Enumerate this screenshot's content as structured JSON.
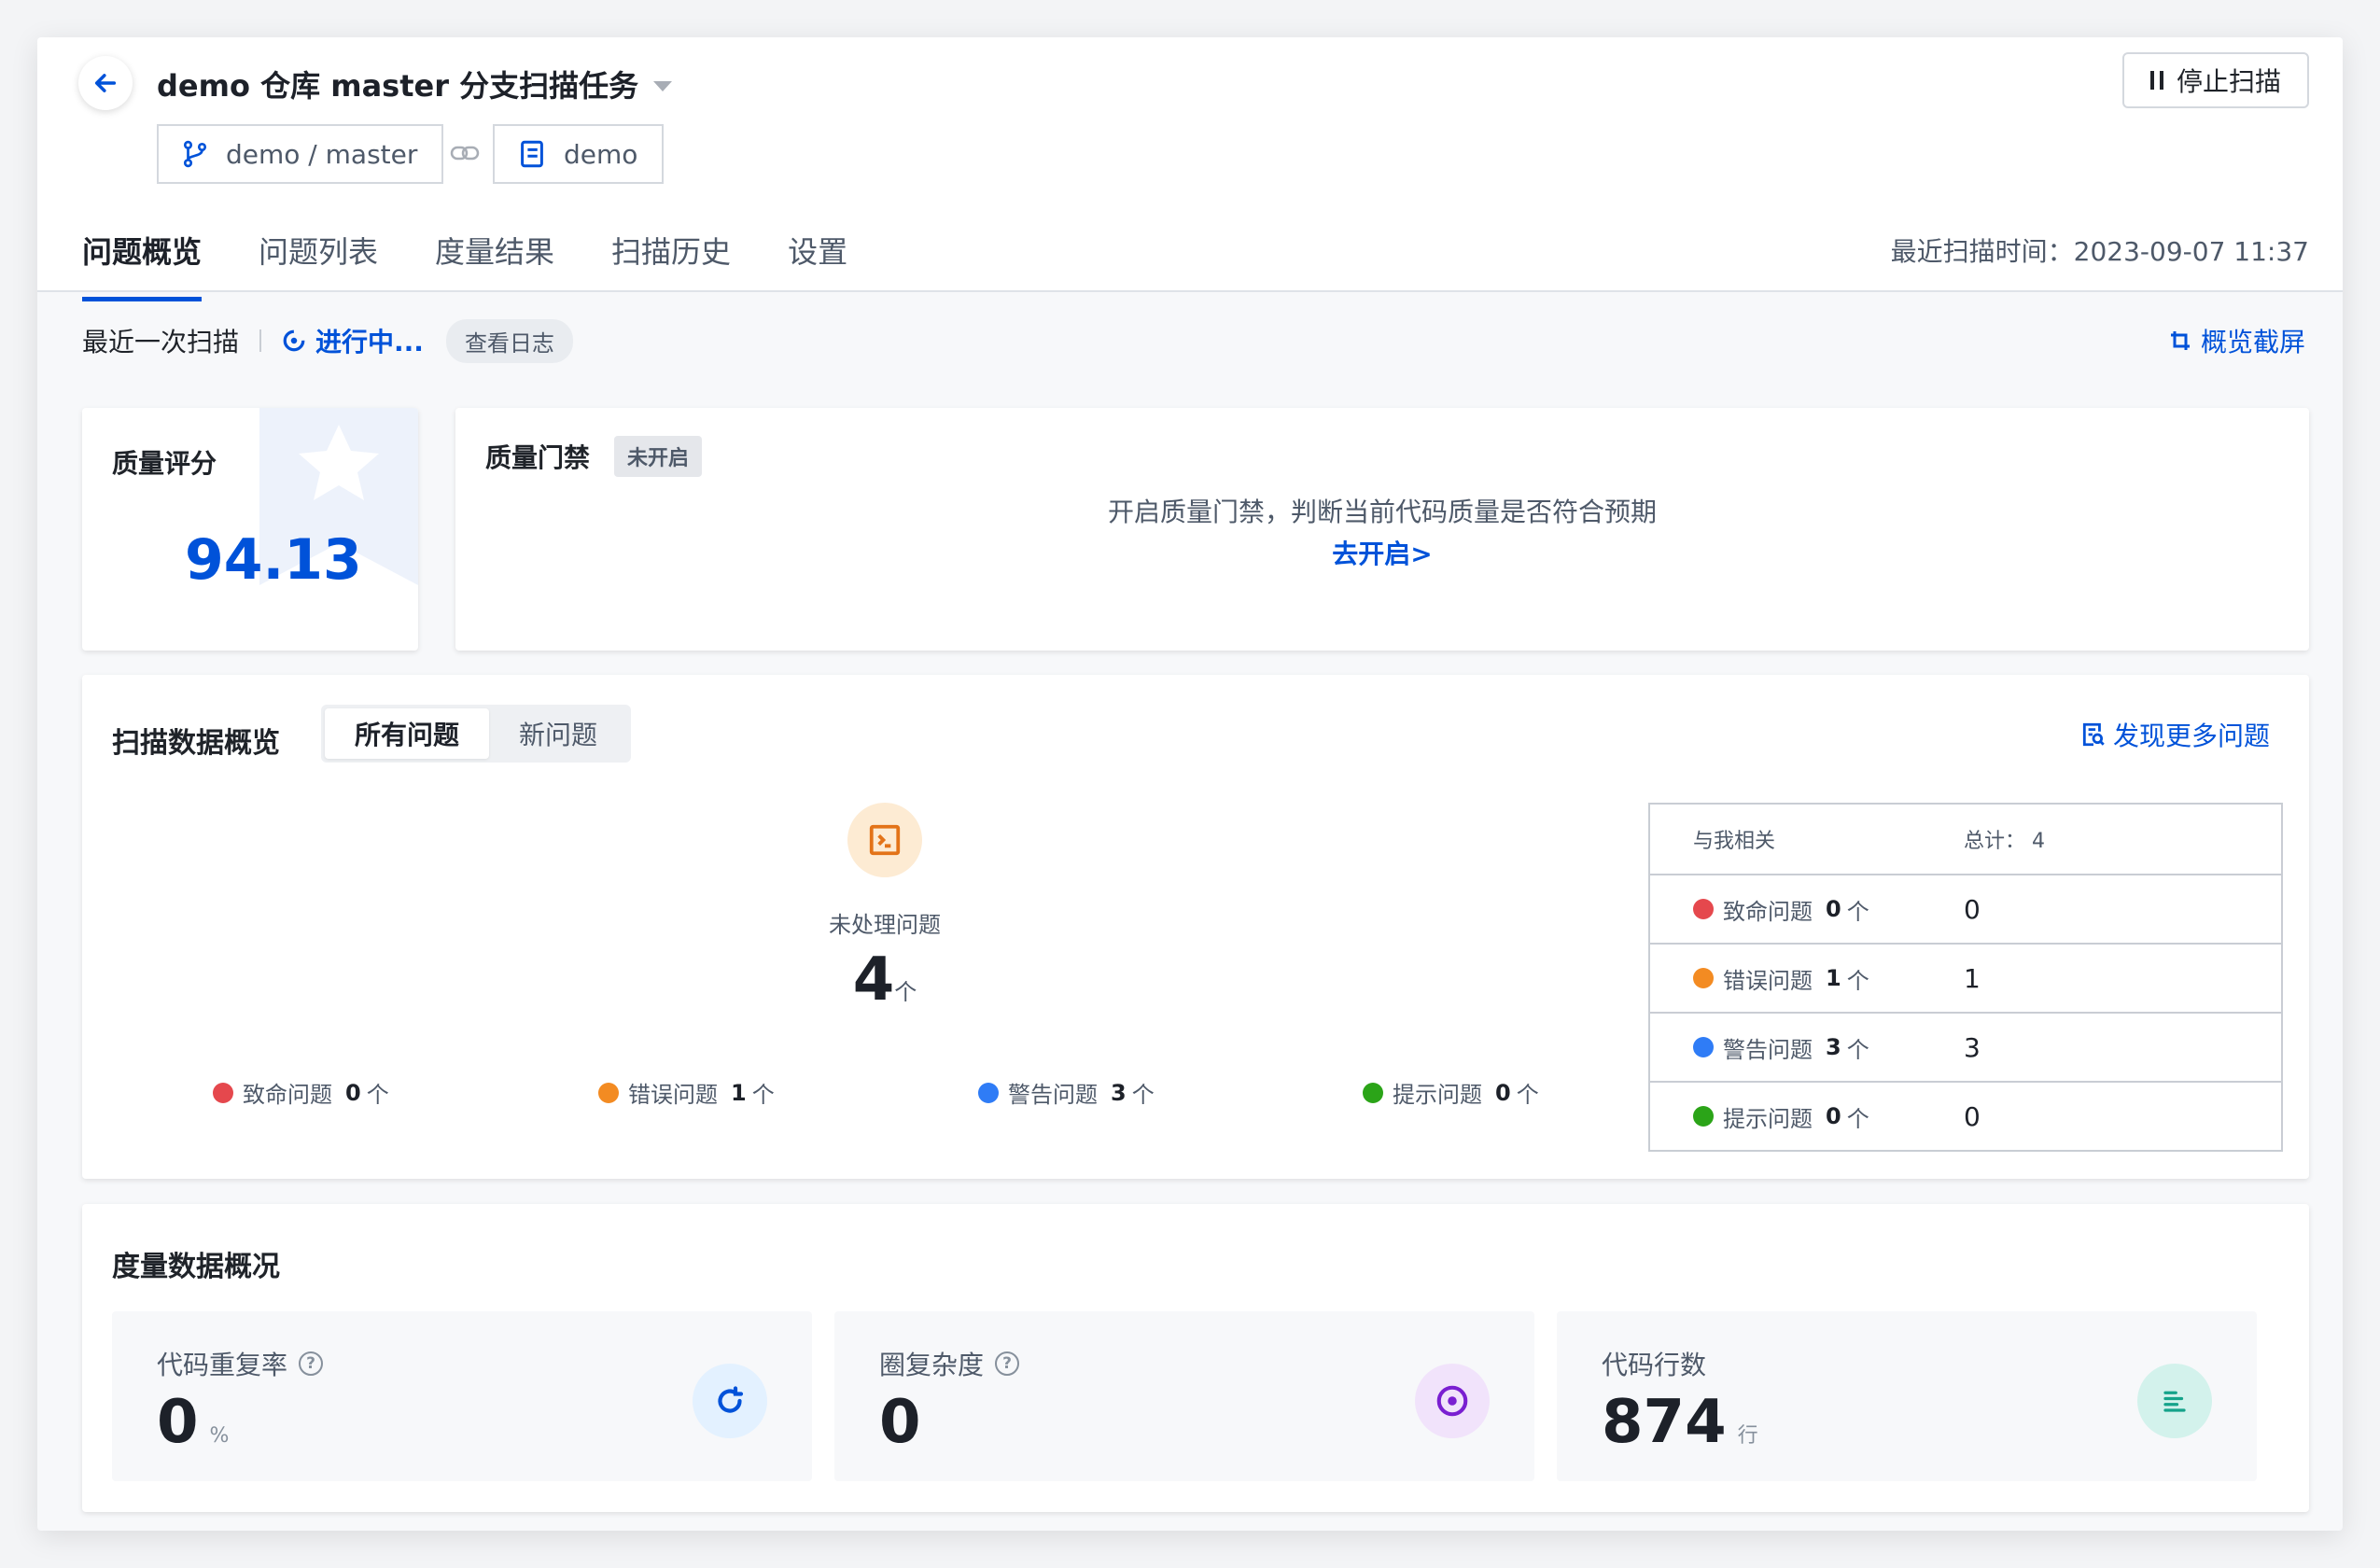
{
  "header": {
    "title": "demo 仓库 master 分支扫描任务",
    "stop_button": "停止扫描",
    "branch_tag": "demo / master",
    "repo_tag": "demo",
    "last_scan_time": "最近扫描时间：2023-09-07 11:37"
  },
  "tabs": [
    {
      "label": "问题概览",
      "active": true
    },
    {
      "label": "问题列表",
      "active": false
    },
    {
      "label": "度量结果",
      "active": false
    },
    {
      "label": "扫描历史",
      "active": false
    },
    {
      "label": "设置",
      "active": false
    }
  ],
  "status_bar": {
    "label": "最近一次扫描",
    "status": "进行中...",
    "view_log": "查看日志",
    "screenshot": "概览截屏"
  },
  "quality_score": {
    "title": "质量评分",
    "value": "94.13"
  },
  "quality_gate": {
    "title": "质量门禁",
    "badge": "未开启",
    "hint": "开启质量门禁，判断当前代码质量是否符合预期",
    "link": "去开启>"
  },
  "scan_overview": {
    "title": "扫描数据概览",
    "segments": [
      "所有问题",
      "新问题"
    ],
    "more_link": "发现更多问题",
    "unprocessed_label": "未处理问题",
    "unprocessed_count": "4",
    "unprocessed_unit": "个",
    "legend": [
      {
        "label": "致命问题",
        "count": "0",
        "unit": "个",
        "color": "#e5484d"
      },
      {
        "label": "错误问题",
        "count": "1",
        "unit": "个",
        "color": "#f38b22"
      },
      {
        "label": "警告问题",
        "count": "3",
        "unit": "个",
        "color": "#2f7cf6"
      },
      {
        "label": "提示问题",
        "count": "0",
        "unit": "个",
        "color": "#2ba418"
      }
    ],
    "related_table": {
      "header_label": "与我相关",
      "header_total": "总计： 4",
      "rows": [
        {
          "label": "致命问题",
          "count": "0",
          "unit": "个",
          "value": "0"
        },
        {
          "label": "错误问题",
          "count": "1",
          "unit": "个",
          "value": "1"
        },
        {
          "label": "警告问题",
          "count": "3",
          "unit": "个",
          "value": "3"
        },
        {
          "label": "提示问题",
          "count": "0",
          "unit": "个",
          "value": "0"
        }
      ]
    }
  },
  "metrics": {
    "title": "度量数据概况",
    "items": [
      {
        "label": "代码重复率",
        "value": "0",
        "unit": "%",
        "icon": "refresh-icon",
        "icon_bg": "#e3f1ff",
        "icon_color": "#0052d9"
      },
      {
        "label": "圈复杂度",
        "value": "0",
        "unit": "",
        "icon": "target-icon",
        "icon_bg": "#f1e3fb",
        "icon_color": "#7a1fd1"
      },
      {
        "label": "代码行数",
        "value": "874",
        "unit": "行",
        "icon": "lines-icon",
        "icon_bg": "#d3f2ec",
        "icon_color": "#15a38a"
      }
    ]
  }
}
